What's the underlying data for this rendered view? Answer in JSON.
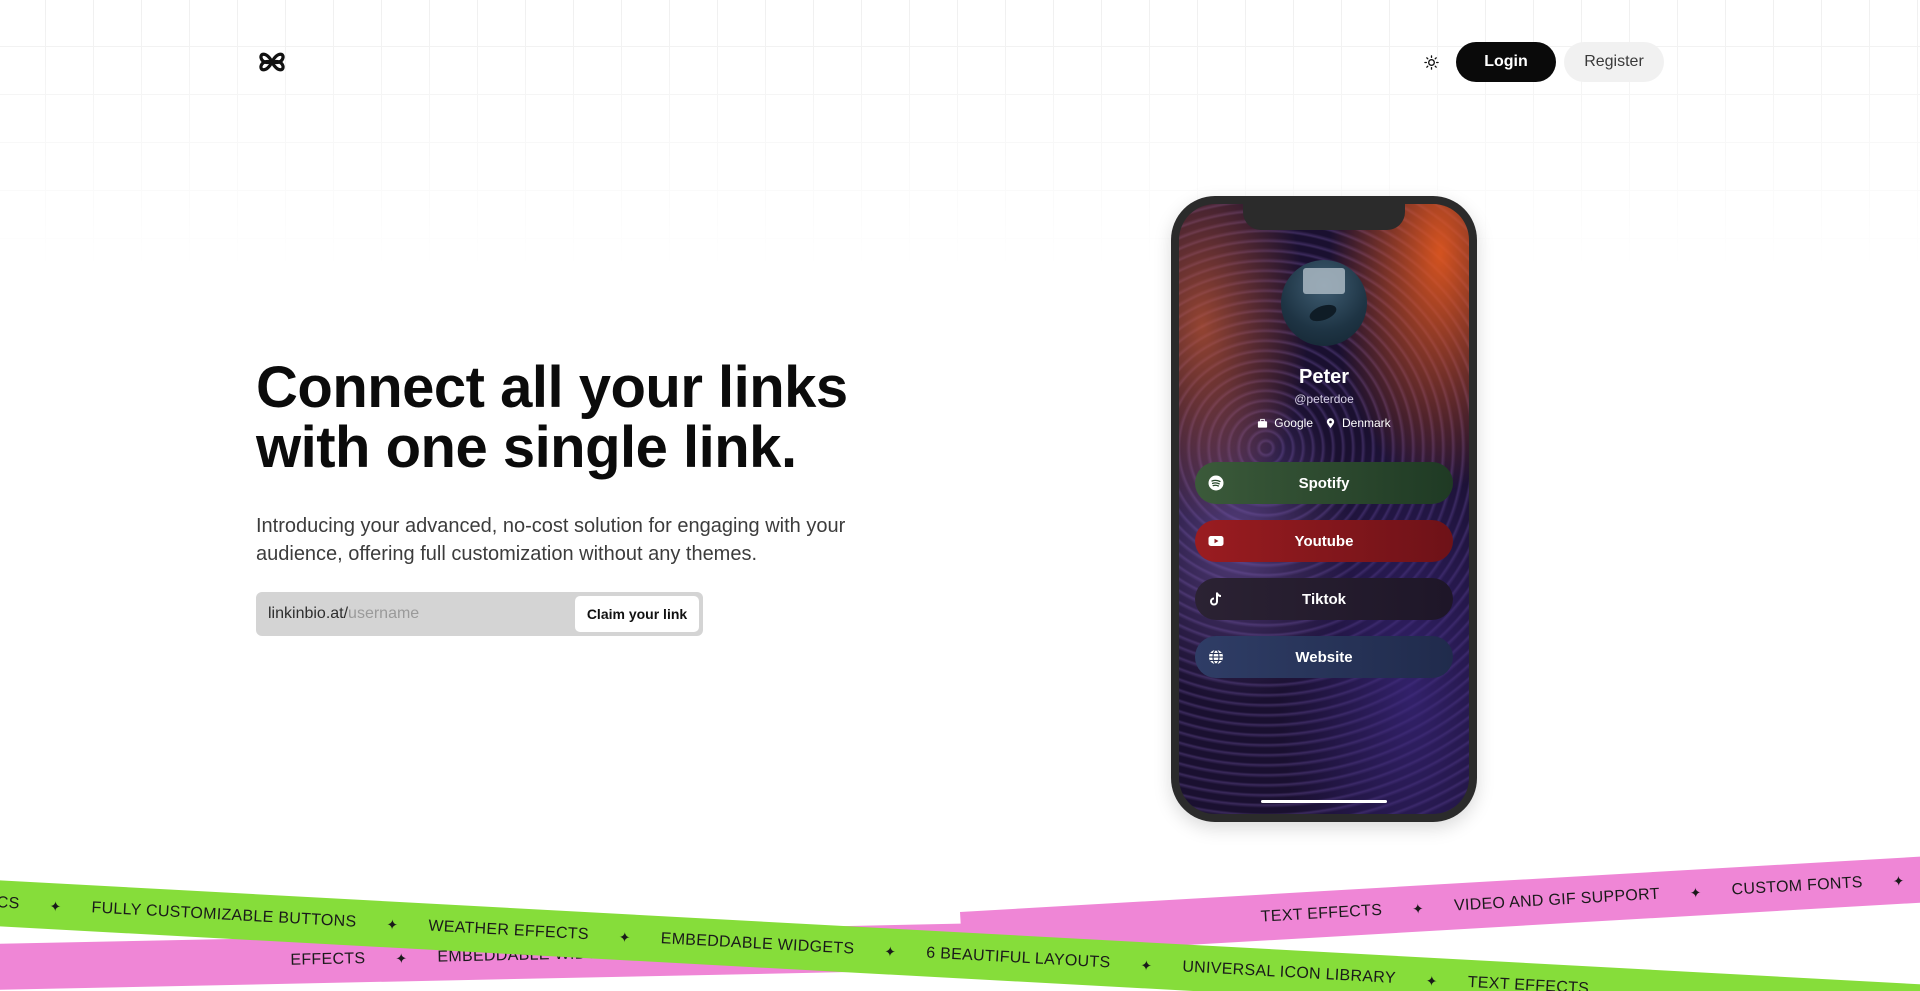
{
  "header": {
    "logo_icon": "clover-link-logo-icon",
    "theme_icon": "sun-icon",
    "login_label": "Login",
    "register_label": "Register"
  },
  "hero": {
    "title_line1": "Connect all your links",
    "title_line2": "with one single link.",
    "subtitle_line1": "Introducing your advanced, no-cost solution for engaging with your",
    "subtitle_line2": "audience, offering full customization without any themes.",
    "claim": {
      "prefix": "linkinbio.at/",
      "placeholder": "username",
      "button_label": "Claim your link"
    }
  },
  "phone_preview": {
    "name": "Peter",
    "handle": "@peterdoe",
    "company": "Google",
    "location": "Denmark",
    "links": [
      {
        "label": "Spotify",
        "icon": "spotify-icon",
        "color": "#2a4a2e"
      },
      {
        "label": "Youtube",
        "icon": "youtube-icon",
        "color": "#8a1a1f"
      },
      {
        "label": "Tiktok",
        "icon": "tiktok-icon",
        "color": "#2a1f33"
      },
      {
        "label": "Website",
        "icon": "globe-icon",
        "color": "#263357"
      }
    ]
  },
  "ribbons": {
    "green_items": [
      "CS",
      "FULLY CUSTOMIZABLE BUTTONS",
      "WEATHER EFFECTS",
      "EMBEDDABLE WIDGETS",
      "6 BEAUTIFUL LAYOUTS",
      "UNIVERSAL ICON LIBRARY",
      "TEXT EFFECTS"
    ],
    "pink_items": [
      "TEXT EFFECTS",
      "VIDEO AND GIF SUPPORT",
      "CUSTOM FONTS"
    ],
    "pink_bottom_items": [
      "EFFECTS",
      "EMBEDDABLE WIDGETS"
    ],
    "star": "✦",
    "colors": {
      "green": "#86dd3a",
      "pink": "#ef86d6"
    }
  }
}
